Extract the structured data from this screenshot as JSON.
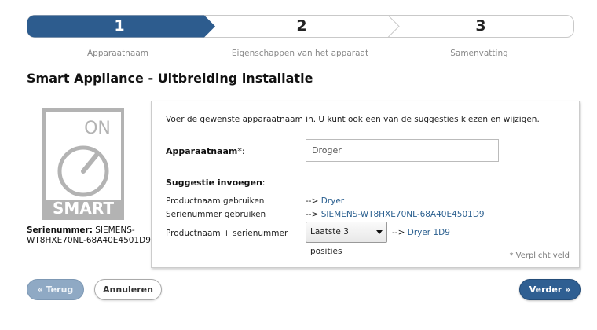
{
  "stepper": {
    "steps": [
      {
        "number": "1",
        "label": "Apparaatnaam",
        "active": true
      },
      {
        "number": "2",
        "label": "Eigenschappen van het apparaat",
        "active": false
      },
      {
        "number": "3",
        "label": "Samenvatting",
        "active": false
      }
    ],
    "active_color": "#2d5c8e"
  },
  "page_title": "Smart Appliance - Uitbreiding installatie",
  "device": {
    "image_icon": "smart-appliance-on-icon",
    "image_text_top": "ON",
    "image_text_bottom": "SMART",
    "serial_label": "Serienummer:",
    "serial_value": "SIEMENS-WT8HXE70NL-68A40E4501D9"
  },
  "form": {
    "intro": "Voer de gewenste apparaatnaam in. U kunt ook een van de suggesties kiezen en wijzigen.",
    "name_label": "Apparaatnaam",
    "name_label_suffix": "*:",
    "name_value": "Droger",
    "suggestion_heading": "Suggestie invoegen",
    "suggestion_heading_suffix": ":",
    "suggestions": [
      {
        "label": "Productnaam gebruiken",
        "arrow": "-->",
        "value": "Dryer"
      },
      {
        "label": "Serienummer gebruiken",
        "arrow": "-->",
        "value": "SIEMENS-WT8HXE70NL-68A40E4501D9"
      }
    ],
    "combo": {
      "label": "Productnaam + serienummer",
      "select_value": "Laatste 3 posities",
      "arrow": "-->",
      "value": "Dryer 1D9"
    },
    "required_note": "* Verplicht veld"
  },
  "buttons": {
    "back": "« Terug",
    "cancel": "Annuleren",
    "next": "Verder »"
  }
}
